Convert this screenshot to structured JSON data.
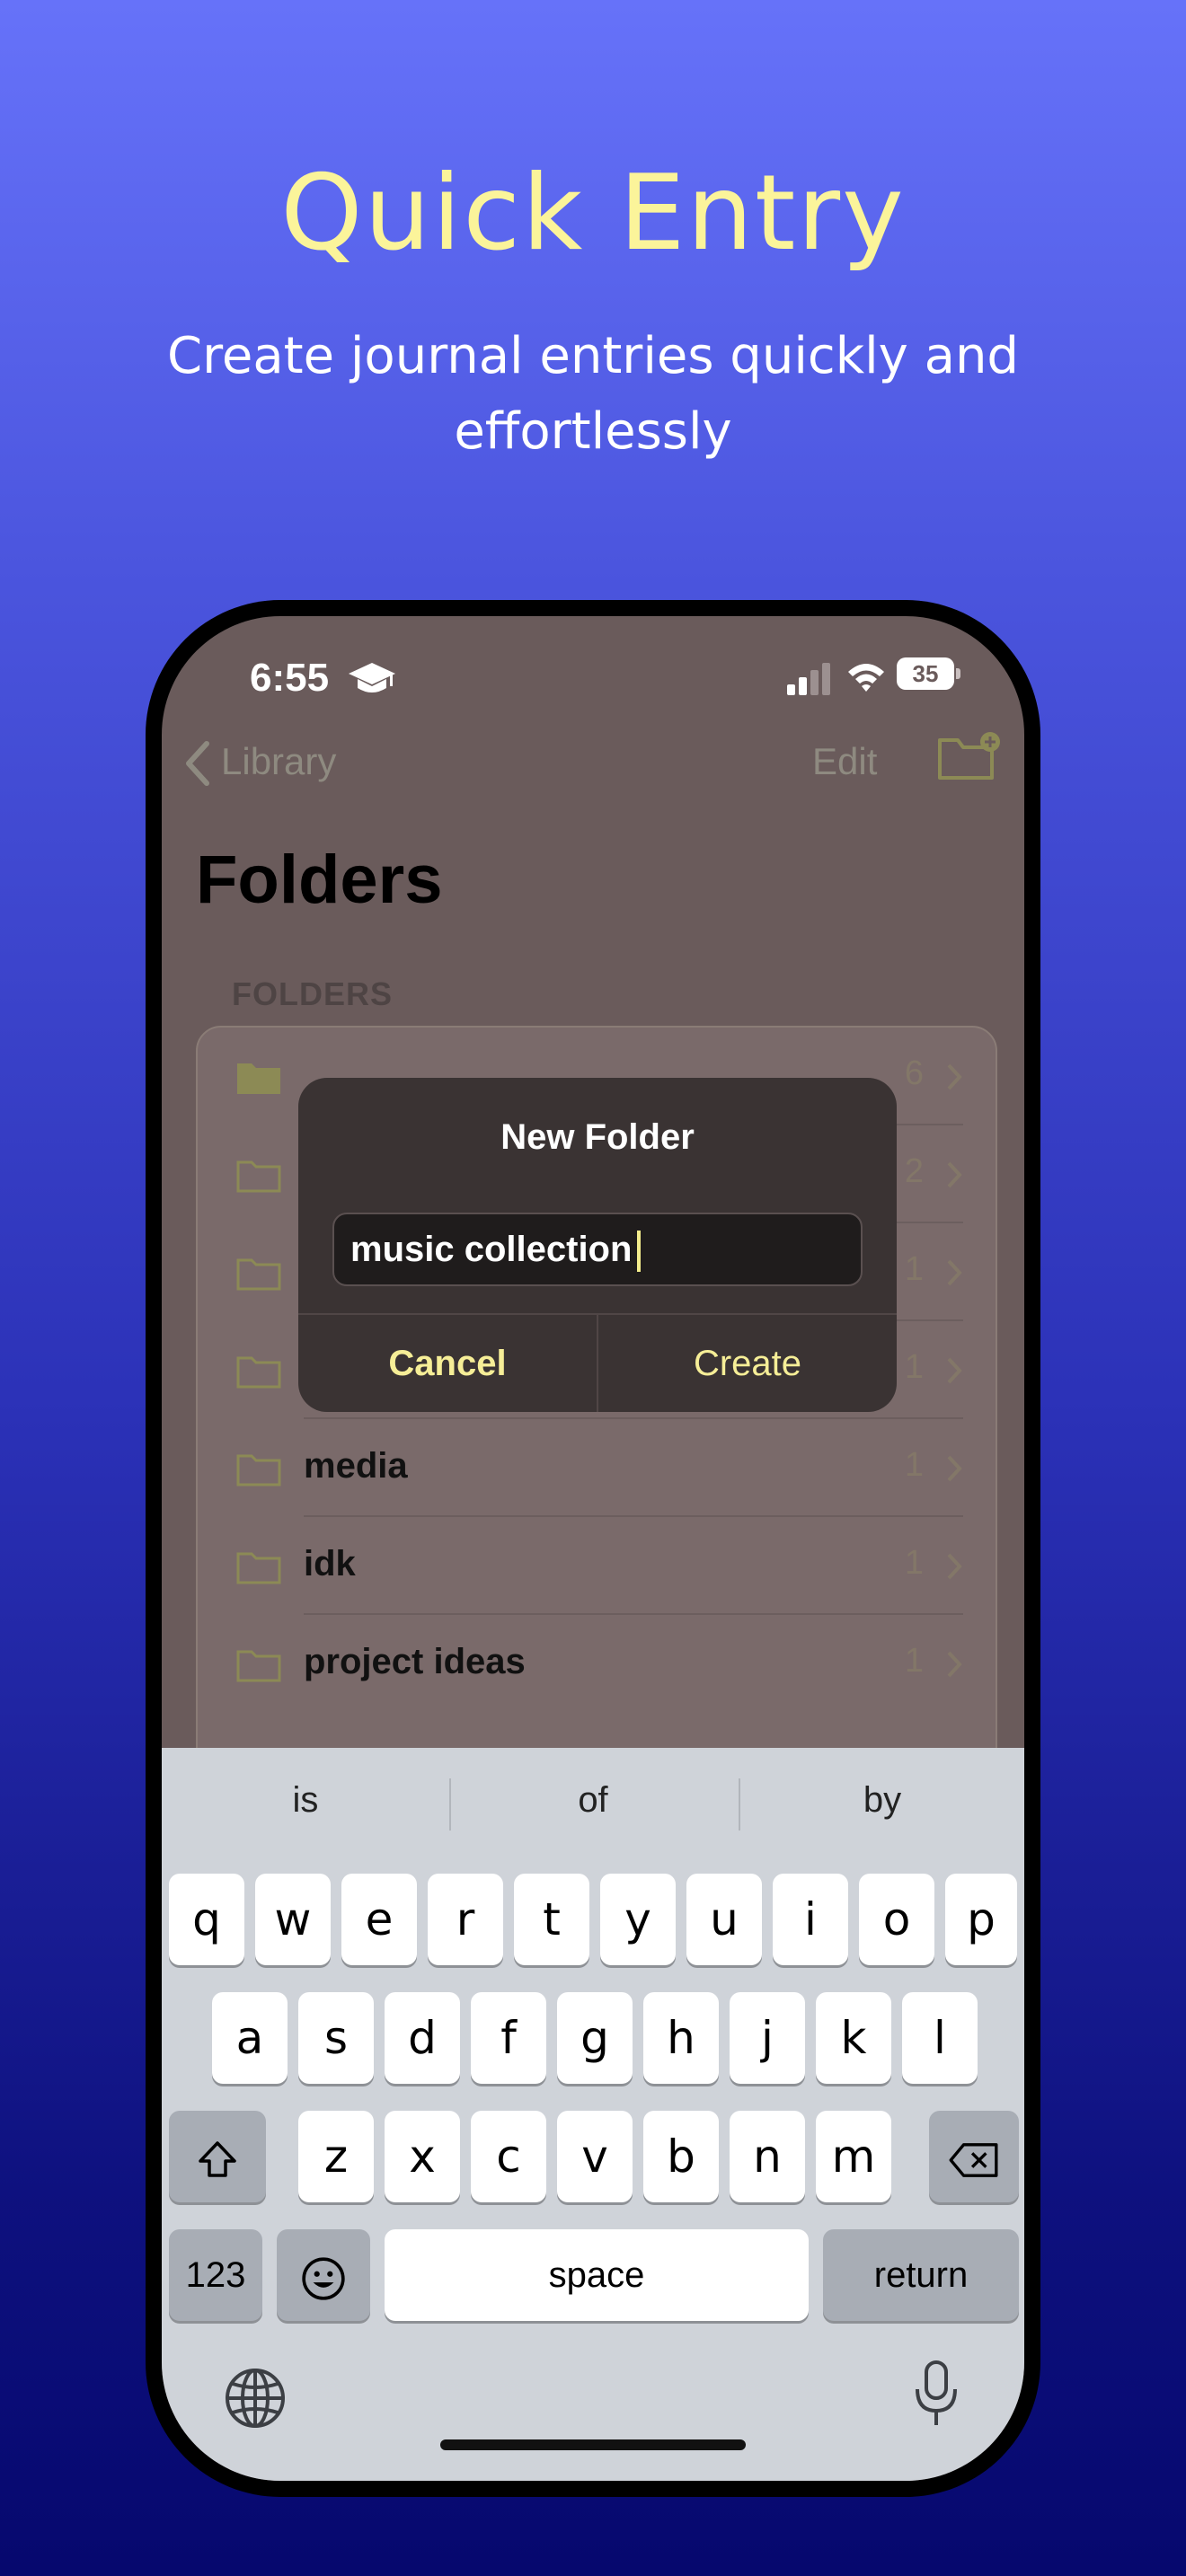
{
  "hero": {
    "title": "Quick Entry",
    "subtitle": "Create journal entries quickly and effortlessly"
  },
  "status_bar": {
    "time": "6:55",
    "battery": "35",
    "icons": [
      "graduation-cap-icon",
      "signal-icon",
      "wifi-icon",
      "battery-icon"
    ]
  },
  "nav": {
    "back_label": "Library",
    "edit_label": "Edit",
    "new_folder_icon": "folder-plus-icon"
  },
  "page": {
    "title": "Folders",
    "section_header": "FOLDERS"
  },
  "folders": [
    {
      "name": "",
      "count": "6"
    },
    {
      "name": "",
      "count": "2"
    },
    {
      "name": "",
      "count": "1"
    },
    {
      "name": "",
      "count": "1"
    },
    {
      "name": "media",
      "count": "1"
    },
    {
      "name": "idk",
      "count": "1"
    },
    {
      "name": "project ideas",
      "count": "1"
    }
  ],
  "dialog": {
    "title": "New Folder",
    "input_value": "music collection",
    "cancel_label": "Cancel",
    "create_label": "Create"
  },
  "keyboard": {
    "suggestions": [
      "is",
      "of",
      "by"
    ],
    "row1": [
      "q",
      "w",
      "e",
      "r",
      "t",
      "y",
      "u",
      "i",
      "o",
      "p"
    ],
    "row2": [
      "a",
      "s",
      "d",
      "f",
      "g",
      "h",
      "j",
      "k",
      "l"
    ],
    "row3": [
      "z",
      "x",
      "c",
      "v",
      "b",
      "n",
      "m"
    ],
    "numbers_label": "123",
    "space_label": "space",
    "return_label": "return"
  },
  "colors": {
    "accent": "#f6ee97",
    "title_yellow": "#fbf49a"
  }
}
